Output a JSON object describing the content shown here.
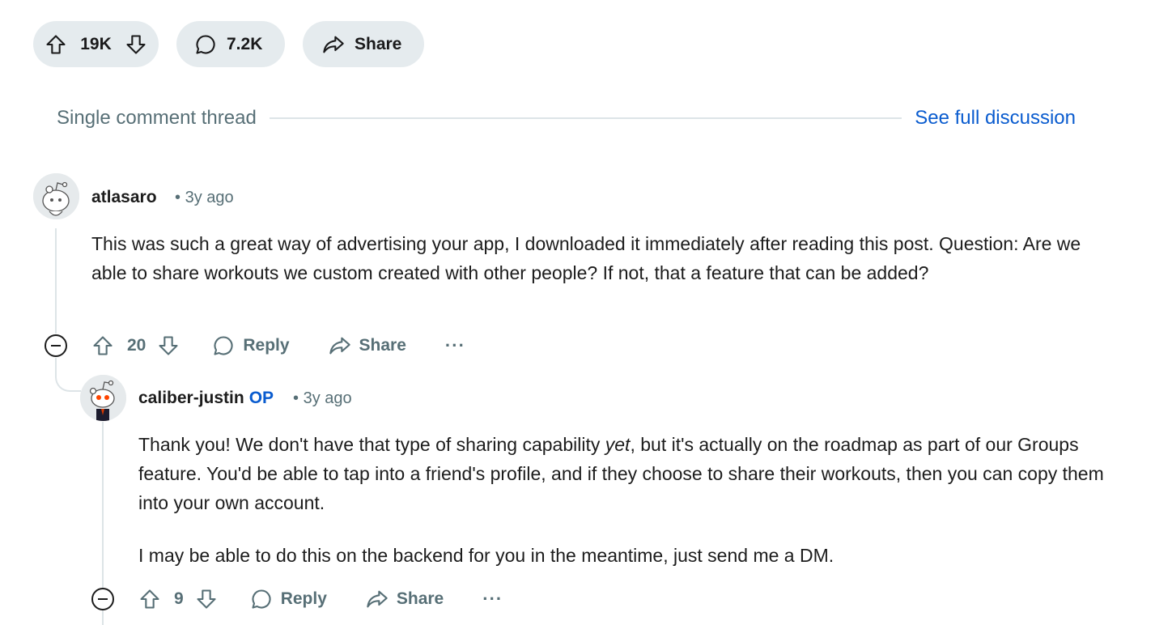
{
  "post_actions": {
    "vote_count": "19K",
    "comment_count": "7.2K",
    "share_label": "Share"
  },
  "thread_header": {
    "label": "Single comment thread",
    "link": "See full discussion"
  },
  "comments": [
    {
      "author": "atlasaro",
      "separator": "•",
      "time": "3y ago",
      "body": [
        "This was such a great way of advertising your app, I downloaded it immediately after reading this post. Question: Are we able to share workouts we custom created with other people? If not, that a feature that can be added?"
      ],
      "votes": "20",
      "reply_label": "Reply",
      "share_label": "Share",
      "more_label": "···"
    },
    {
      "author": "caliber-justin",
      "op_badge": "OP",
      "separator": "•",
      "time": "3y ago",
      "body_p1_before": "Thank you! We don't have that type of sharing capability ",
      "body_p1_em": "yet",
      "body_p1_after": ", but it's actually on the roadmap as part of our Groups feature. You'd be able to tap into a friend's profile, and if they choose to share their workouts, then you can copy them into your own account.",
      "body_p2": "I may be able to do this on the backend for you in the meantime, just send me a DM.",
      "votes": "9",
      "reply_label": "Reply",
      "share_label": "Share",
      "more_label": "···"
    }
  ],
  "icons": {
    "upvote": "upvote-icon",
    "downvote": "downvote-icon",
    "comment": "comment-icon",
    "share": "share-icon",
    "collapse": "collapse-icon",
    "more": "more-icon"
  },
  "colors": {
    "pill_bg": "#e5ebee",
    "link": "#0a5ccf",
    "muted": "#576f76",
    "thread_line": "#dde4e7"
  }
}
